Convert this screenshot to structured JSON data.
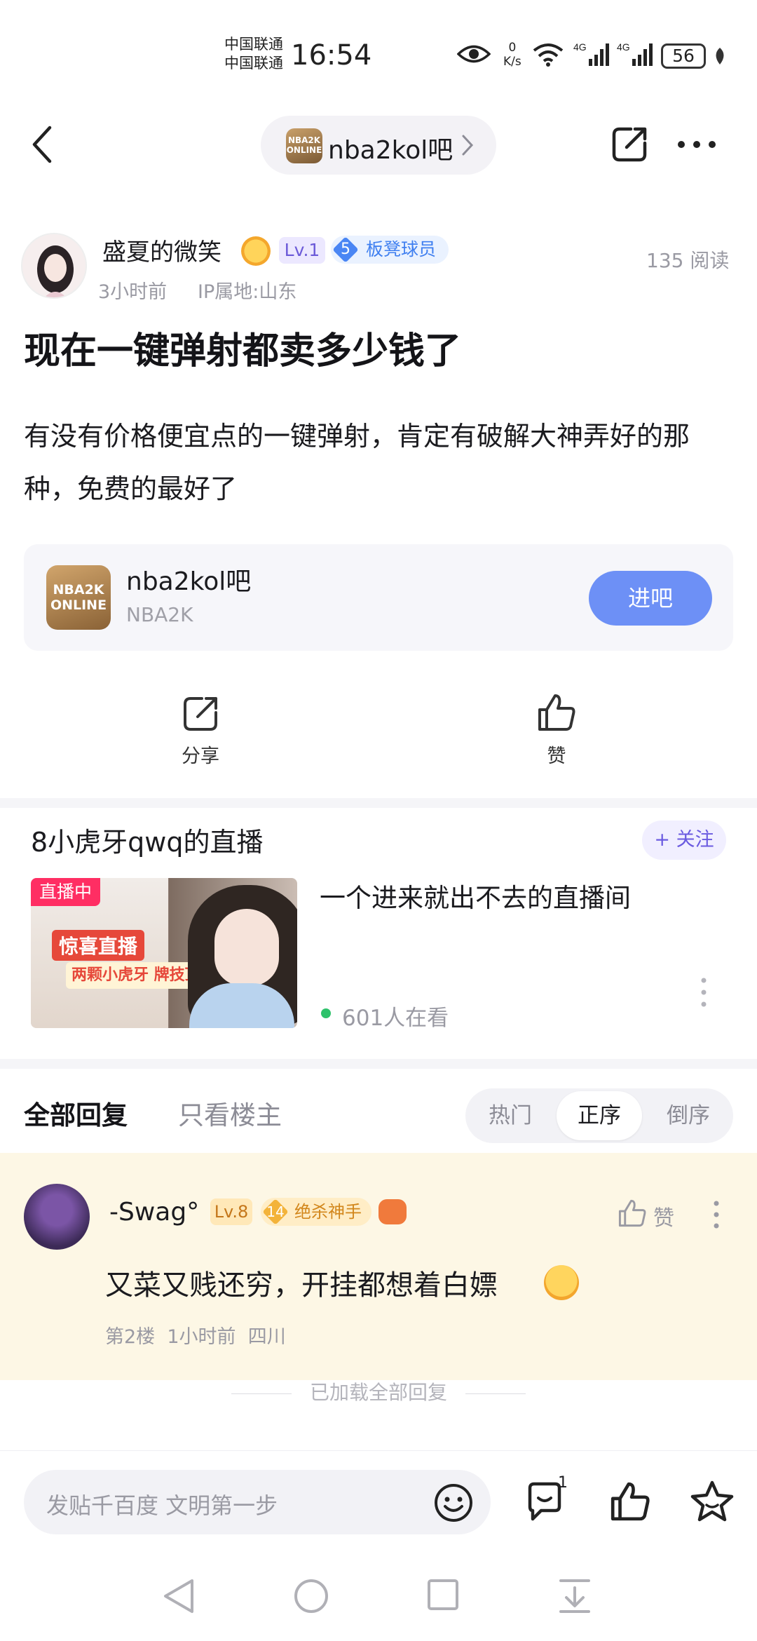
{
  "status_bar": {
    "carrier_1": "中国联通",
    "carrier_2": "中国联通",
    "time": "16:54",
    "net_speed_value": "0",
    "net_speed_unit": "K/s",
    "signal_1": "4G",
    "signal_2": "4G",
    "battery": "56",
    "icons": [
      "eye-icon",
      "wifi-icon",
      "signal-icon",
      "battery-icon",
      "leaf-icon"
    ]
  },
  "header": {
    "forum_name": "nba2kol吧",
    "forum_logo_text": "NBA2K ONLINE",
    "icons": [
      "back-icon",
      "chevron-right-icon",
      "share-icon",
      "more-icon"
    ]
  },
  "post": {
    "author": "盛夏的微笑",
    "level": "Lv.1",
    "rank_number": "5",
    "rank_title": "板凳球员",
    "time": "3小时前",
    "ip": "IP属地:山东",
    "reads": "135 阅读",
    "title": "现在一键弹射都卖多少钱了",
    "body": "有没有价格便宜点的一键弹射，肯定有破解大神弄好的那种，免费的最好了"
  },
  "forum_card": {
    "name": "nba2kol吧",
    "subtitle": "NBA2K",
    "logo_text": "NBA2K ONLINE",
    "enter_label": "进吧"
  },
  "actions": {
    "share_label": "分享",
    "like_label": "赞"
  },
  "live": {
    "title": "8小虎牙qwq的直播",
    "follow_label": "+ 关注",
    "tag": "直播中",
    "promo_main": "惊喜直播",
    "promo_sub": "两颗小虎牙 牌技顶呱呱",
    "description": "一个进来就出不去的直播间",
    "viewers": "601人在看"
  },
  "replies_header": {
    "tab_all": "全部回复",
    "tab_owner": "只看楼主",
    "sort_options": [
      "热门",
      "正序",
      "倒序"
    ],
    "selected_sort": "正序"
  },
  "reply": {
    "user": "-Swag°",
    "level": "Lv.8",
    "rank_number": "14",
    "rank_title": "绝杀神手",
    "like_label": "赞",
    "text": "又菜又贱还穷，开挂都想着白嫖",
    "floor": "第2楼",
    "time": "1小时前",
    "location": "四川"
  },
  "loaded_all": "已加载全部回复",
  "bottom_bar": {
    "input_placeholder": "发贴千百度 文明第一步",
    "comment_count": "1",
    "icons": [
      "emoji-icon",
      "comment-icon",
      "like-icon",
      "star-icon"
    ]
  },
  "nav_bar": {
    "icons": [
      "nav-back-icon",
      "nav-home-icon",
      "nav-recent-icon",
      "nav-menu-icon"
    ]
  },
  "colors": {
    "accent_blue": "#6d90f6",
    "live_red": "#ff2e63",
    "reply_bg": "#fdf7e5",
    "follow_purple": "#6a5ae0"
  }
}
